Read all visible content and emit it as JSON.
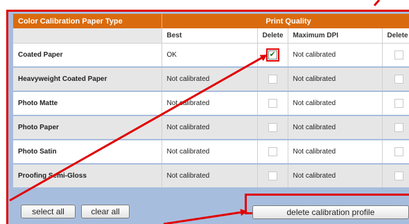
{
  "table": {
    "header": {
      "type_label": "Color Calibration Paper Type",
      "print_quality_label": "Print Quality"
    },
    "subheader": {
      "best": "Best",
      "delete": "Delete",
      "max_dpi": "Maximum DPI",
      "delete2": "Delete"
    },
    "rows": [
      {
        "name": "Coated Paper",
        "best": "OK",
        "best_delete_checked": true,
        "max_dpi": "Not calibrated",
        "max_delete_checked": false
      },
      {
        "name": "Heavyweight Coated Paper",
        "best": "Not calibrated",
        "best_delete_checked": false,
        "max_dpi": "Not calibrated",
        "max_delete_checked": false
      },
      {
        "name": "Photo Matte",
        "best": "Not calibrated",
        "best_delete_checked": false,
        "max_dpi": "Not calibrated",
        "max_delete_checked": false
      },
      {
        "name": "Photo Paper",
        "best": "Not calibrated",
        "best_delete_checked": false,
        "max_dpi": "Not calibrated",
        "max_delete_checked": false
      },
      {
        "name": "Photo Satin",
        "best": "Not calibrated",
        "best_delete_checked": false,
        "max_dpi": "Not calibrated",
        "max_delete_checked": false
      },
      {
        "name": "Proofing Semi-Gloss",
        "best": "Not calibrated",
        "best_delete_checked": false,
        "max_dpi": "Not calibrated",
        "max_delete_checked": false
      }
    ]
  },
  "buttons": {
    "select_all": "select all",
    "clear_all": "clear all",
    "delete_profile": "delete calibration profile"
  },
  "colors": {
    "header_orange": "#d96b0e",
    "panel_blue": "#a7bddd",
    "callout_red": "#e00000"
  }
}
